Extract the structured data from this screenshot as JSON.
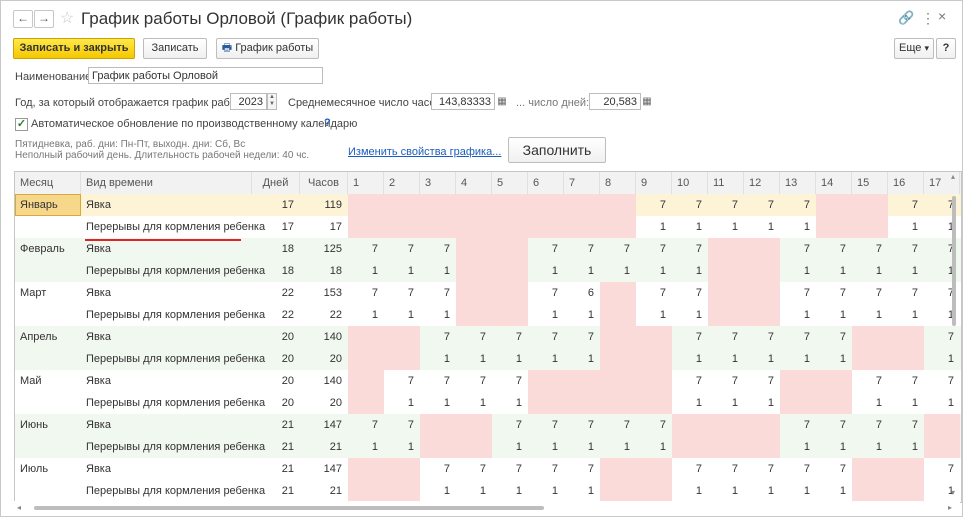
{
  "window": {
    "title": "График работы Орловой (График работы)",
    "back": "←",
    "forward": "→",
    "star": "☆",
    "link_icon": "🔗",
    "more_icon": "⋮",
    "close_icon": "×"
  },
  "toolbar": {
    "save_close": "Записать и закрыть",
    "save": "Записать",
    "schedule_icon": "🖶",
    "schedule": "График работы",
    "more": "Еще",
    "more_arrow": "▾",
    "help": "?"
  },
  "form": {
    "name_label": "Наименование:",
    "name_value": "График работы Орловой",
    "year_label": "Год, за который отображается график работы:",
    "year_value": "2023",
    "avg_hours_label": "Среднемесячное число часов:",
    "avg_hours_value": "143,83333",
    "days_label": "... число дней:",
    "days_value": "20,583",
    "calc_icon": "▦",
    "spin_up": "▲",
    "spin_down": "▼",
    "auto_update_label": "Автоматическое обновление по производственному календарю",
    "auto_update_checked": true,
    "checkmark": "✓",
    "help_mark": "?",
    "info_line1": "Пятидневка, раб. дни: Пн-Пт, выходн. дни: Сб, Вс",
    "info_line2": "Неполный рабочий день. Длительность рабочей недели: 40 чс.",
    "change_link": "Изменить свойства графика...",
    "fill_button": "Заполнить"
  },
  "table": {
    "headers": [
      "Месяц",
      "Вид времени",
      "Дней",
      "Часов",
      "1",
      "2",
      "3",
      "4",
      "5",
      "6",
      "7",
      "8",
      "9",
      "10",
      "11",
      "12",
      "13",
      "14",
      "15",
      "16",
      "17"
    ],
    "rows": [
      {
        "month": "Январь",
        "type": "Явка",
        "days": "17",
        "hours": "119",
        "selected": true,
        "cells": [
          "",
          "",
          "",
          "",
          "",
          "",
          "",
          "",
          "7",
          "7",
          "7",
          "7",
          "7",
          "",
          "",
          "7",
          "7"
        ],
        "off": [
          0,
          1,
          2,
          3,
          4,
          5,
          6,
          7,
          13,
          14
        ]
      },
      {
        "month": "",
        "type": "Перерывы для кормления ребенка",
        "days": "17",
        "hours": "17",
        "selected": false,
        "cells": [
          "",
          "",
          "",
          "",
          "",
          "",
          "",
          "",
          "1",
          "1",
          "1",
          "1",
          "1",
          "",
          "",
          "1",
          "1"
        ],
        "off": [
          0,
          1,
          2,
          3,
          4,
          5,
          6,
          7,
          13,
          14
        ]
      },
      {
        "month": "Февраль",
        "type": "Явка",
        "days": "18",
        "hours": "125",
        "selected": false,
        "cells": [
          "7",
          "7",
          "7",
          "",
          "",
          "7",
          "7",
          "7",
          "7",
          "7",
          "",
          "",
          "7",
          "7",
          "7",
          "7",
          "7"
        ],
        "off": [
          3,
          4,
          10,
          11
        ]
      },
      {
        "month": "",
        "type": "Перерывы для кормления ребенка",
        "days": "18",
        "hours": "18",
        "selected": false,
        "cells": [
          "1",
          "1",
          "1",
          "",
          "",
          "1",
          "1",
          "1",
          "1",
          "1",
          "",
          "",
          "1",
          "1",
          "1",
          "1",
          "1"
        ],
        "off": [
          3,
          4,
          10,
          11
        ]
      },
      {
        "month": "Март",
        "type": "Явка",
        "days": "22",
        "hours": "153",
        "selected": false,
        "cells": [
          "7",
          "7",
          "7",
          "",
          "",
          "7",
          "6",
          "",
          "7",
          "7",
          "",
          "",
          "7",
          "7",
          "7",
          "7",
          "7"
        ],
        "off": [
          3,
          4,
          7,
          10,
          11
        ]
      },
      {
        "month": "",
        "type": "Перерывы для кормления ребенка",
        "days": "22",
        "hours": "22",
        "selected": false,
        "cells": [
          "1",
          "1",
          "1",
          "",
          "",
          "1",
          "1",
          "",
          "1",
          "1",
          "",
          "",
          "1",
          "1",
          "1",
          "1",
          "1"
        ],
        "off": [
          3,
          4,
          7,
          10,
          11
        ]
      },
      {
        "month": "Апрель",
        "type": "Явка",
        "days": "20",
        "hours": "140",
        "selected": false,
        "cells": [
          "",
          "",
          "7",
          "7",
          "7",
          "7",
          "7",
          "",
          "",
          "7",
          "7",
          "7",
          "7",
          "7",
          "",
          "",
          "7"
        ],
        "off": [
          0,
          1,
          7,
          8,
          14,
          15
        ]
      },
      {
        "month": "",
        "type": "Перерывы для кормления ребенка",
        "days": "20",
        "hours": "20",
        "selected": false,
        "cells": [
          "",
          "",
          "1",
          "1",
          "1",
          "1",
          "1",
          "",
          "",
          "1",
          "1",
          "1",
          "1",
          "1",
          "",
          "",
          "1"
        ],
        "off": [
          0,
          1,
          7,
          8,
          14,
          15
        ]
      },
      {
        "month": "Май",
        "type": "Явка",
        "days": "20",
        "hours": "140",
        "selected": false,
        "cells": [
          "",
          "7",
          "7",
          "7",
          "7",
          "",
          "",
          "",
          "",
          "7",
          "7",
          "7",
          "",
          "",
          "7",
          "7",
          "7"
        ],
        "off": [
          0,
          5,
          6,
          7,
          8,
          12,
          13
        ]
      },
      {
        "month": "",
        "type": "Перерывы для кормления ребенка",
        "days": "20",
        "hours": "20",
        "selected": false,
        "cells": [
          "",
          "1",
          "1",
          "1",
          "1",
          "",
          "",
          "",
          "",
          "1",
          "1",
          "1",
          "",
          "",
          "1",
          "1",
          "1"
        ],
        "off": [
          0,
          5,
          6,
          7,
          8,
          12,
          13
        ]
      },
      {
        "month": "Июнь",
        "type": "Явка",
        "days": "21",
        "hours": "147",
        "selected": false,
        "cells": [
          "7",
          "7",
          "",
          "",
          "7",
          "7",
          "7",
          "7",
          "7",
          "",
          "",
          "",
          "7",
          "7",
          "7",
          "7",
          ""
        ],
        "off": [
          2,
          3,
          9,
          10,
          11,
          16
        ]
      },
      {
        "month": "",
        "type": "Перерывы для кормления ребенка",
        "days": "21",
        "hours": "21",
        "selected": false,
        "cells": [
          "1",
          "1",
          "",
          "",
          "1",
          "1",
          "1",
          "1",
          "1",
          "",
          "",
          "",
          "1",
          "1",
          "1",
          "1",
          ""
        ],
        "off": [
          2,
          3,
          9,
          10,
          11,
          16
        ]
      },
      {
        "month": "Июль",
        "type": "Явка",
        "days": "21",
        "hours": "147",
        "selected": false,
        "cells": [
          "",
          "",
          "7",
          "7",
          "7",
          "7",
          "7",
          "",
          "",
          "7",
          "7",
          "7",
          "7",
          "7",
          "",
          "",
          "7"
        ],
        "off": [
          0,
          1,
          7,
          8,
          14,
          15
        ]
      },
      {
        "month": "",
        "type": "Перерывы для кормления ребенка",
        "days": "21",
        "hours": "21",
        "selected": false,
        "cells": [
          "",
          "",
          "1",
          "1",
          "1",
          "1",
          "1",
          "",
          "",
          "1",
          "1",
          "1",
          "1",
          "1",
          "",
          "",
          "1"
        ],
        "off": [
          0,
          1,
          7,
          8,
          14,
          15
        ]
      }
    ]
  },
  "colors": {
    "off_day": "#fbdada",
    "work_day": "#ffffff",
    "selected_row": "#fdf3d6",
    "green_row": "#f1f8ef",
    "accent_link": "#1a5dbd"
  },
  "scroll": {
    "left": "◂",
    "right": "▸",
    "up": "▴",
    "down": "▾"
  }
}
